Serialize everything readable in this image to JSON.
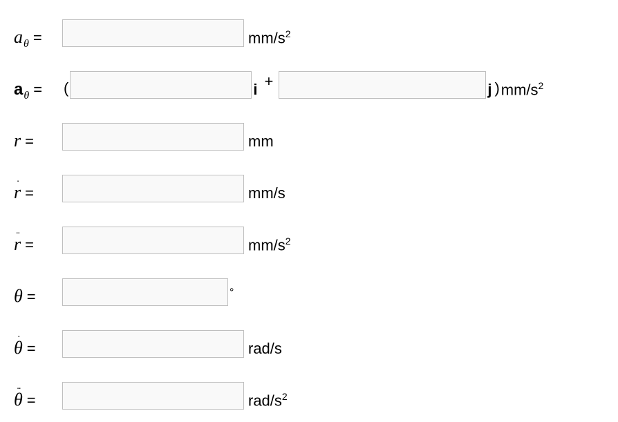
{
  "rows": {
    "a_theta_mag": {
      "symbol": "a",
      "subscript": "θ",
      "decor": "",
      "bold": false,
      "eq": " =",
      "unit_html": "mm/s<sup>2</sup>"
    },
    "a_theta_vec": {
      "symbol": "a",
      "subscript": "θ",
      "decor": "",
      "bold": true,
      "eq": " =",
      "open": "(",
      "i": "i",
      "plus": "+",
      "j": "j",
      "close": ")",
      "unit_html": " mm/s<sup>2</sup>"
    },
    "r": {
      "symbol": "r",
      "subscript": "",
      "decor": "",
      "bold": false,
      "eq": " =",
      "unit_html": "mm"
    },
    "r_dot": {
      "symbol": "r",
      "subscript": "",
      "decor": "·",
      "bold": false,
      "eq": " =",
      "unit_html": "mm/s"
    },
    "r_ddot": {
      "symbol": "r",
      "subscript": "",
      "decor": "··",
      "bold": false,
      "eq": " =",
      "unit_html": "mm/s<sup>2</sup>"
    },
    "theta": {
      "symbol": "θ",
      "subscript": "",
      "decor": "",
      "bold": false,
      "eq": " =",
      "unit_html": "°"
    },
    "theta_dot": {
      "symbol": "θ",
      "subscript": "",
      "decor": "·",
      "bold": false,
      "eq": " =",
      "unit_html": "rad/s"
    },
    "theta_ddot": {
      "symbol": "θ",
      "subscript": "",
      "decor": "··",
      "bold": false,
      "eq": "=",
      "unit_html": "rad/s<sup>2</sup>"
    }
  },
  "values": {
    "a_theta_mag": "",
    "a_theta_vec_i": "",
    "a_theta_vec_j": "",
    "r": "",
    "r_dot": "",
    "r_ddot": "",
    "theta": "",
    "theta_dot": "",
    "theta_ddot": ""
  }
}
